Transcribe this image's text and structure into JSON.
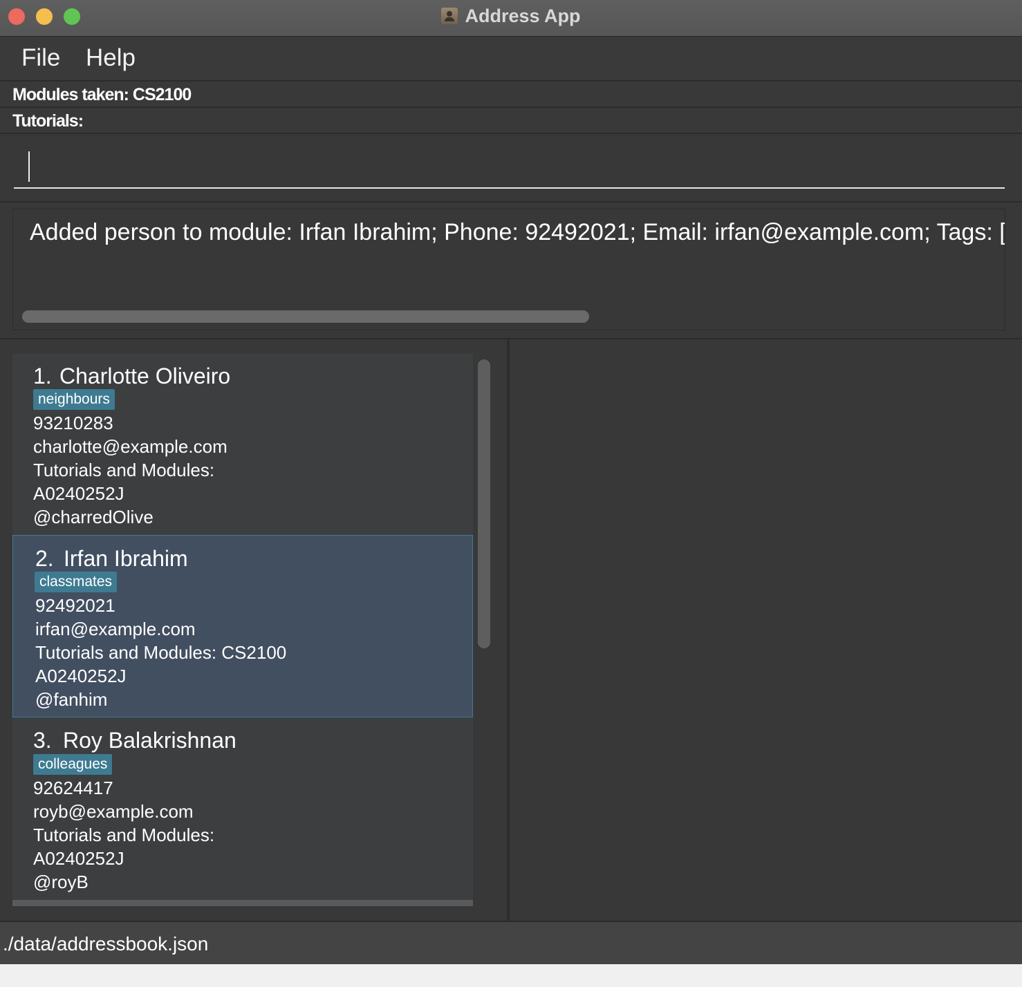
{
  "window": {
    "title": "Address App",
    "icon": "address-book-icon"
  },
  "menu": {
    "file": "File",
    "help": "Help"
  },
  "info": {
    "modules": "Modules taken: CS2100",
    "tutorials": "Tutorials:"
  },
  "command": {
    "value": "",
    "placeholder": ""
  },
  "result": {
    "text": "Added person to module: Irfan Ibrahim; Phone: 92492021; Email: irfan@example.com; Tags: [classmates]"
  },
  "persons": [
    {
      "index": "1.",
      "name": "Charlotte Oliveiro",
      "tag": "neighbours",
      "phone": "93210283",
      "email": "charlotte@example.com",
      "modules": "Tutorials and Modules:",
      "id": "A0240252J",
      "handle": "@charredOlive"
    },
    {
      "index": "2.",
      "name": "Irfan Ibrahim",
      "tag": "classmates",
      "phone": "92492021",
      "email": "irfan@example.com",
      "modules": "Tutorials and Modules: CS2100",
      "id": "A0240252J",
      "handle": "@fanhim"
    },
    {
      "index": "3.",
      "name": "Roy Balakrishnan",
      "tag": "colleagues",
      "phone": "92624417",
      "email": "royb@example.com",
      "modules": "Tutorials and Modules:",
      "id": "A0240252J",
      "handle": "@royB"
    }
  ],
  "status": {
    "path": "./data/addressbook.json"
  },
  "colors": {
    "tag": "#3e7b91",
    "selected": "#424f61",
    "background": "#383838"
  }
}
